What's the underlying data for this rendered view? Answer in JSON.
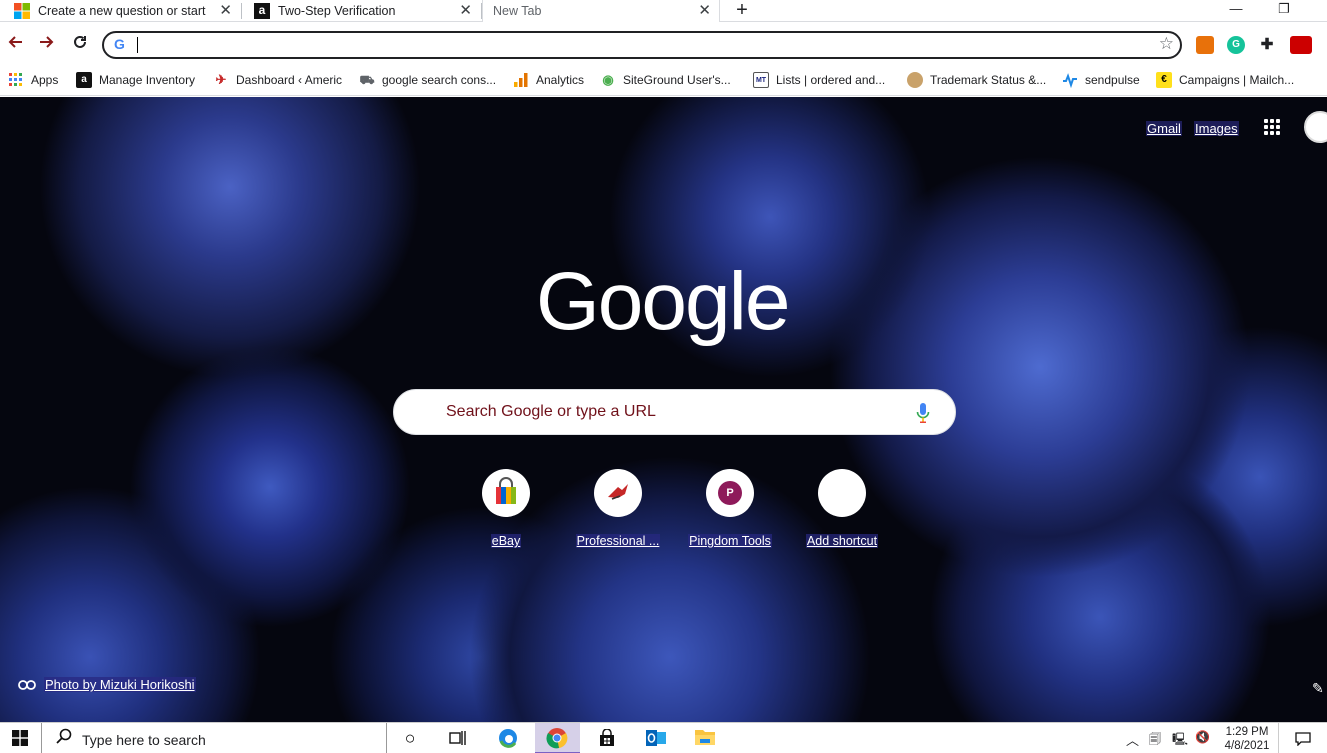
{
  "tabs": [
    {
      "title": "Create a new question or start a"
    },
    {
      "title": "Two-Step Verification"
    },
    {
      "title": "New Tab"
    }
  ],
  "tab_close_glyph": "✕",
  "new_tab_glyph": "+",
  "window_controls": {
    "minimize": "—",
    "maximize": "❐"
  },
  "omnibox": {
    "value": "",
    "g_letter": "G"
  },
  "bookmarks": [
    {
      "label": "Apps"
    },
    {
      "label": "Manage Inventory"
    },
    {
      "label": "Dashboard ‹ Americ"
    },
    {
      "label": "google search cons..."
    },
    {
      "label": "Analytics"
    },
    {
      "label": "SiteGround User's..."
    },
    {
      "label": "Lists | ordered and..."
    },
    {
      "label": "Trademark Status &..."
    },
    {
      "label": "sendpulse"
    },
    {
      "label": "Campaigns | Mailch..."
    }
  ],
  "bookmark_icon_letters": {
    "amazon": "a",
    "mt": "MT",
    "mailchimp": "€"
  },
  "ntp": {
    "gmail": "Gmail",
    "images": "Images",
    "logo": "Google",
    "search_placeholder": "Search Google or type a URL",
    "shortcuts": [
      {
        "label": "eBay"
      },
      {
        "label": "Professional ..."
      },
      {
        "label": "Pingdom Tools",
        "icon_letter": "P"
      },
      {
        "label": "Add shortcut"
      }
    ],
    "photo_credit": "Photo by Mizuki Horikoshi"
  },
  "taskbar": {
    "search_placeholder": "Type here to search",
    "time": "1:29 PM",
    "date": "4/8/2021"
  },
  "colors": {
    "omnibox_border": "#202124",
    "searchbox_placeholder": "#70111a",
    "shortcut_label_bg": "#28287f"
  }
}
